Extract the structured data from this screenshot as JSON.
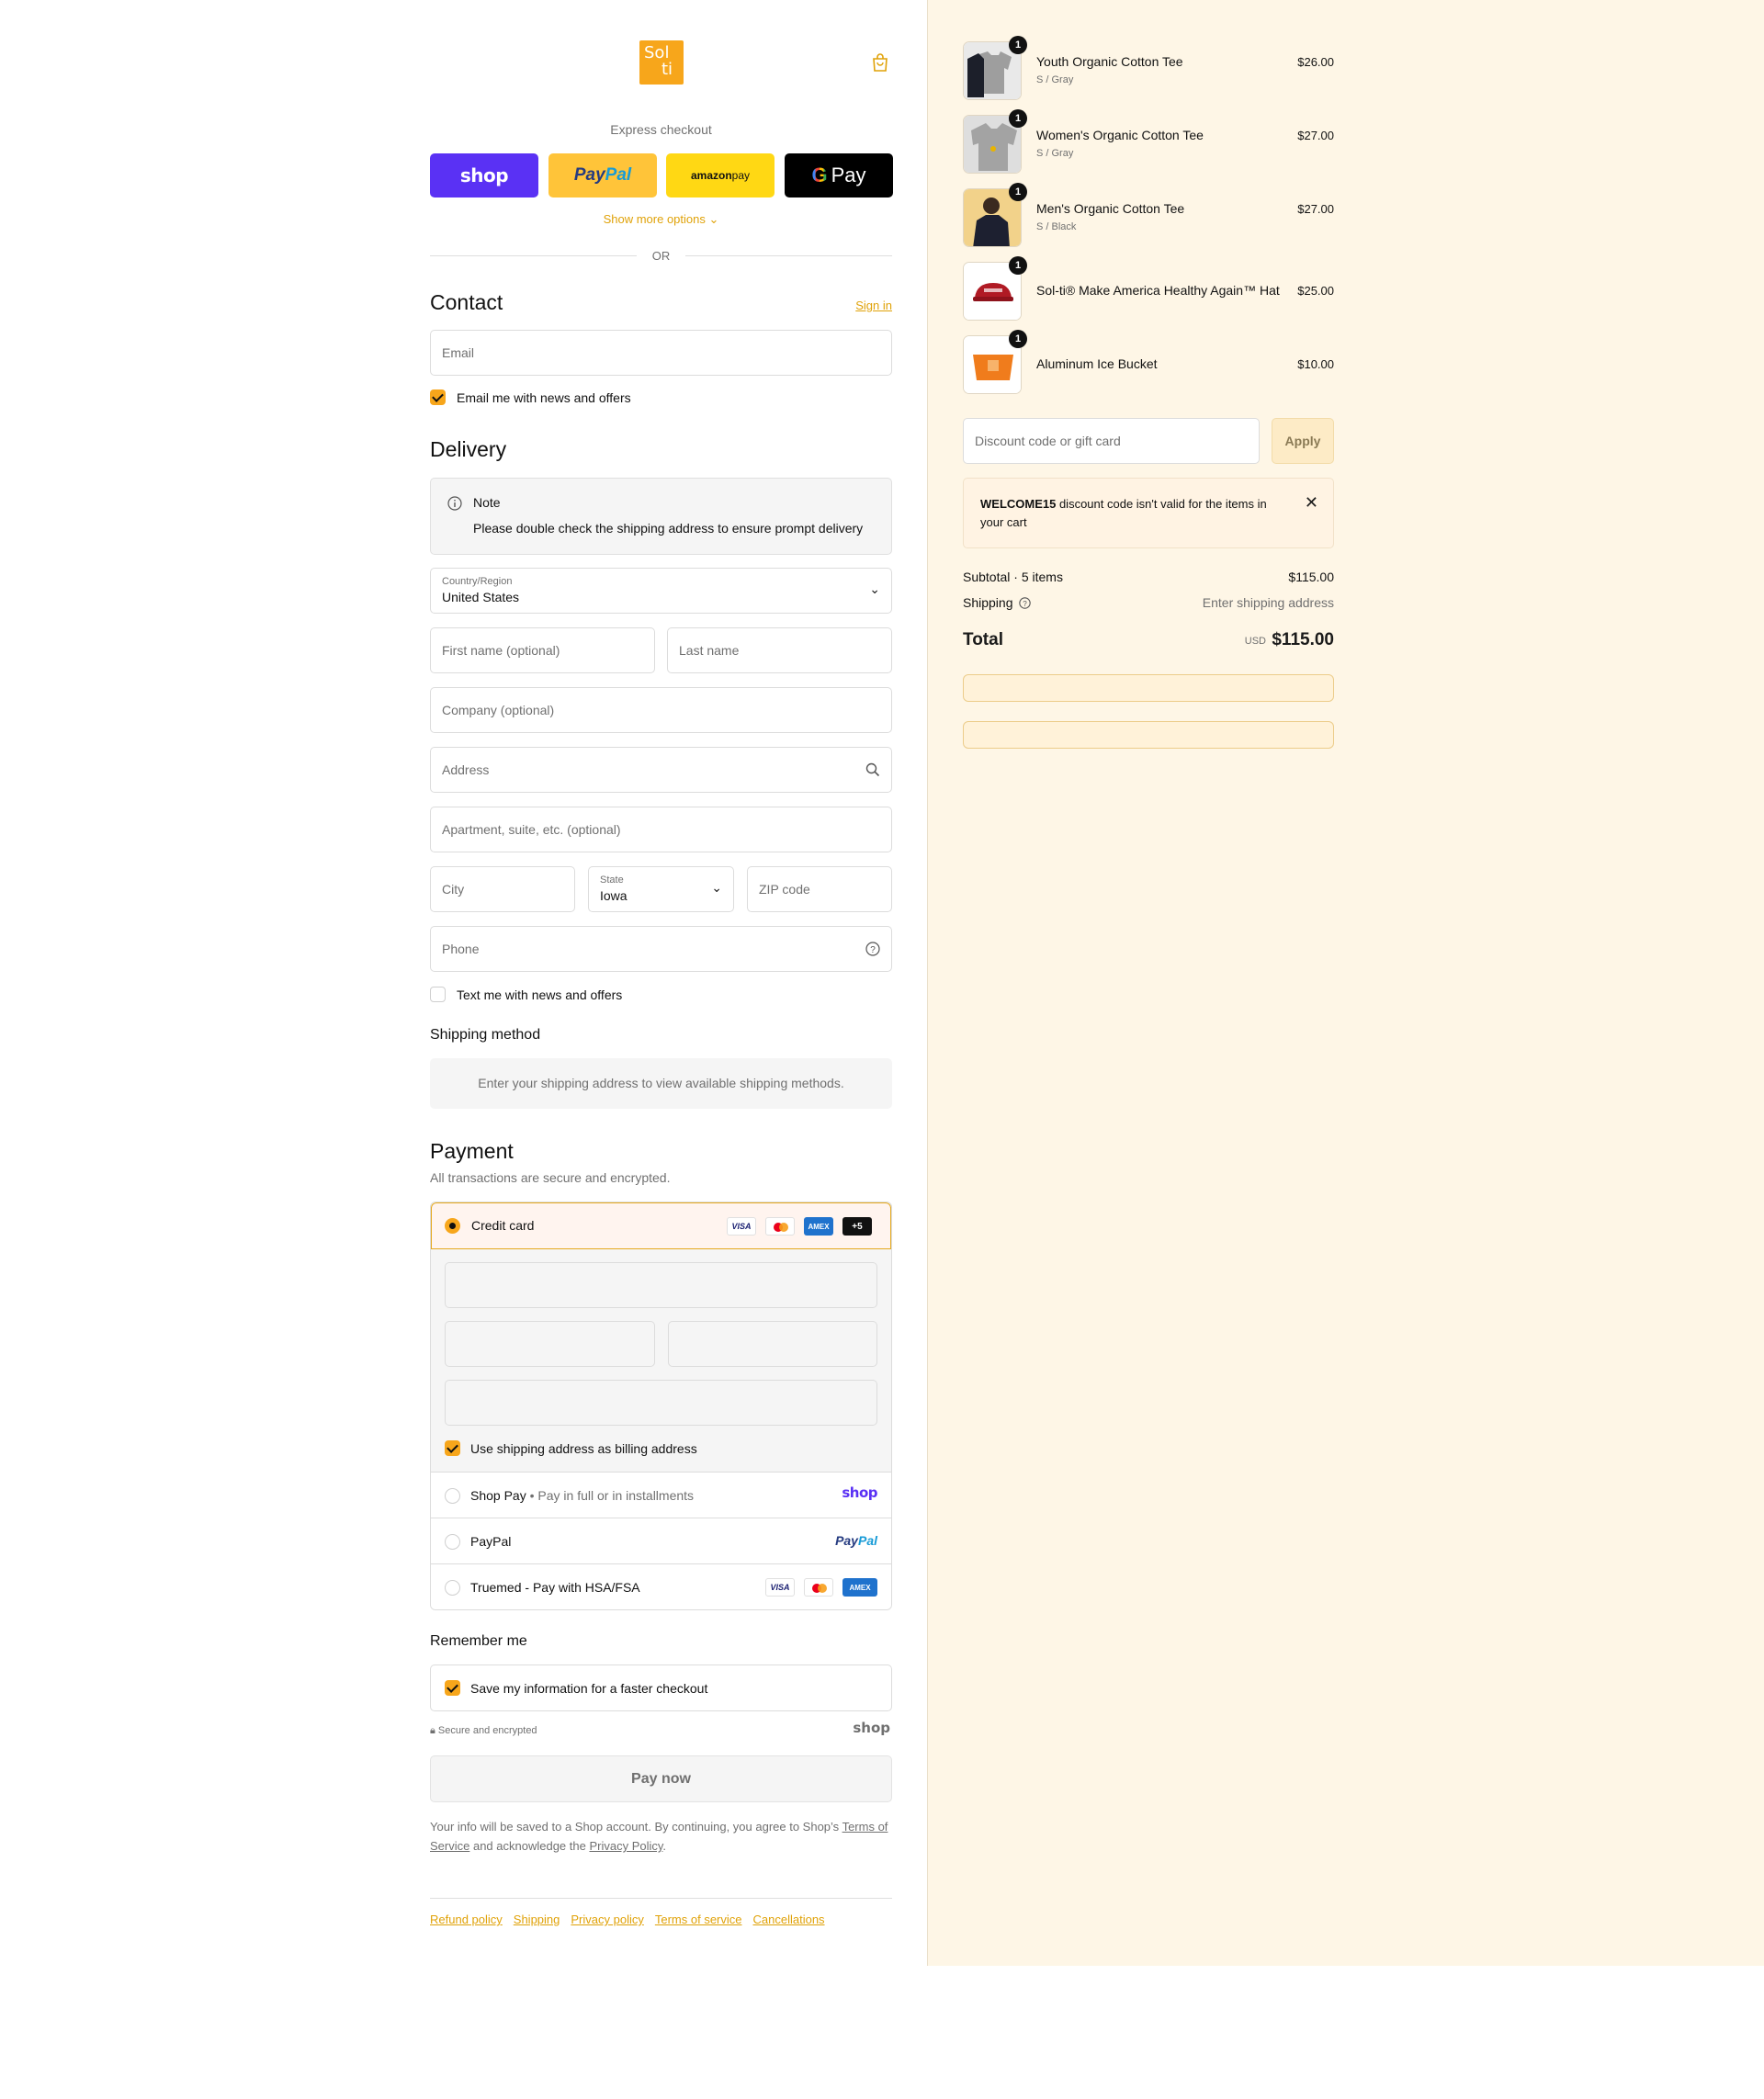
{
  "header": {
    "logo_line1": "Sol",
    "logo_line2": "ti"
  },
  "express": {
    "label": "Express checkout",
    "shop": "shop",
    "paypal_a": "Pay",
    "paypal_b": "Pal",
    "amazon_a": "amazon",
    "amazon_b": " pay",
    "gpay_g": "G",
    "gpay_text": "Pay",
    "show_more": "Show more options",
    "or": "OR"
  },
  "contact": {
    "title": "Contact",
    "sign_in": "Sign in",
    "email_placeholder": "Email",
    "news_label": "Email me with news and offers",
    "news_checked": true
  },
  "delivery": {
    "title": "Delivery",
    "note_title": "Note",
    "note_text": "Please double check the shipping address to ensure prompt delivery",
    "country_label": "Country/Region",
    "country_value": "United States",
    "first_name": "First name (optional)",
    "last_name": "Last name",
    "company": "Company (optional)",
    "address": "Address",
    "apartment": "Apartment, suite, etc. (optional)",
    "city": "City",
    "state_label": "State",
    "state_value": "Iowa",
    "zip": "ZIP code",
    "phone": "Phone",
    "text_label": "Text me with news and offers"
  },
  "shipping": {
    "title": "Shipping method",
    "message": "Enter your shipping address to view available shipping methods."
  },
  "payment": {
    "title": "Payment",
    "subtitle": "All transactions are secure and encrypted.",
    "credit_card": "Credit card",
    "cards": {
      "visa": "VISA",
      "amex": "AMEX",
      "more": "+5"
    },
    "billing_label": "Use shipping address as billing address",
    "shop_pay": "Shop Pay",
    "shop_pay_sub": "Pay in full or in installments",
    "shop_logo": "shop",
    "paypal": "PayPal",
    "truemed": "Truemed - Pay with HSA/FSA"
  },
  "remember": {
    "title": "Remember me",
    "save_label": "Save my information for a faster checkout",
    "secure": "Secure and encrypted",
    "shop_logo": "shop"
  },
  "pay_now": "Pay now",
  "legal": {
    "text1": "Your info will be saved to a Shop account. By continuing, you agree to Shop’s ",
    "tos": "Terms of Service",
    "text2": " and acknowledge the ",
    "privacy": "Privacy Policy",
    "text3": "."
  },
  "footer": [
    "Refund policy",
    "Shipping",
    "Privacy policy",
    "Terms of service",
    "Cancellations"
  ],
  "cart": {
    "items": [
      {
        "name": "Youth Organic Cotton Tee",
        "variant": "S / Gray",
        "price": "$26.00",
        "qty": "1"
      },
      {
        "name": "Women's Organic Cotton Tee",
        "variant": "S / Gray",
        "price": "$27.00",
        "qty": "1"
      },
      {
        "name": "Men's Organic Cotton Tee",
        "variant": "S / Black",
        "price": "$27.00",
        "qty": "1"
      },
      {
        "name": "Sol-ti® Make America Healthy Again™ Hat",
        "variant": "",
        "price": "$25.00",
        "qty": "1"
      },
      {
        "name": "Aluminum Ice Bucket",
        "variant": "",
        "price": "$10.00",
        "qty": "1"
      }
    ],
    "discount_placeholder": "Discount code or gift card",
    "apply": "Apply",
    "warning_code": "WELCOME15",
    "warning_text": " discount code isn't valid for the items in your cart",
    "subtotal_label": "Subtotal · 5 items",
    "subtotal_value": "$115.00",
    "shipping_label": "Shipping",
    "shipping_value": "Enter shipping address",
    "total_label": "Total",
    "currency": "USD",
    "total_value": "$115.00"
  },
  "colors": {
    "accent": "#f7a61b",
    "link": "#e0a208",
    "sidebar_bg": "#fef6e6",
    "shop_purple": "#5a31f4"
  }
}
